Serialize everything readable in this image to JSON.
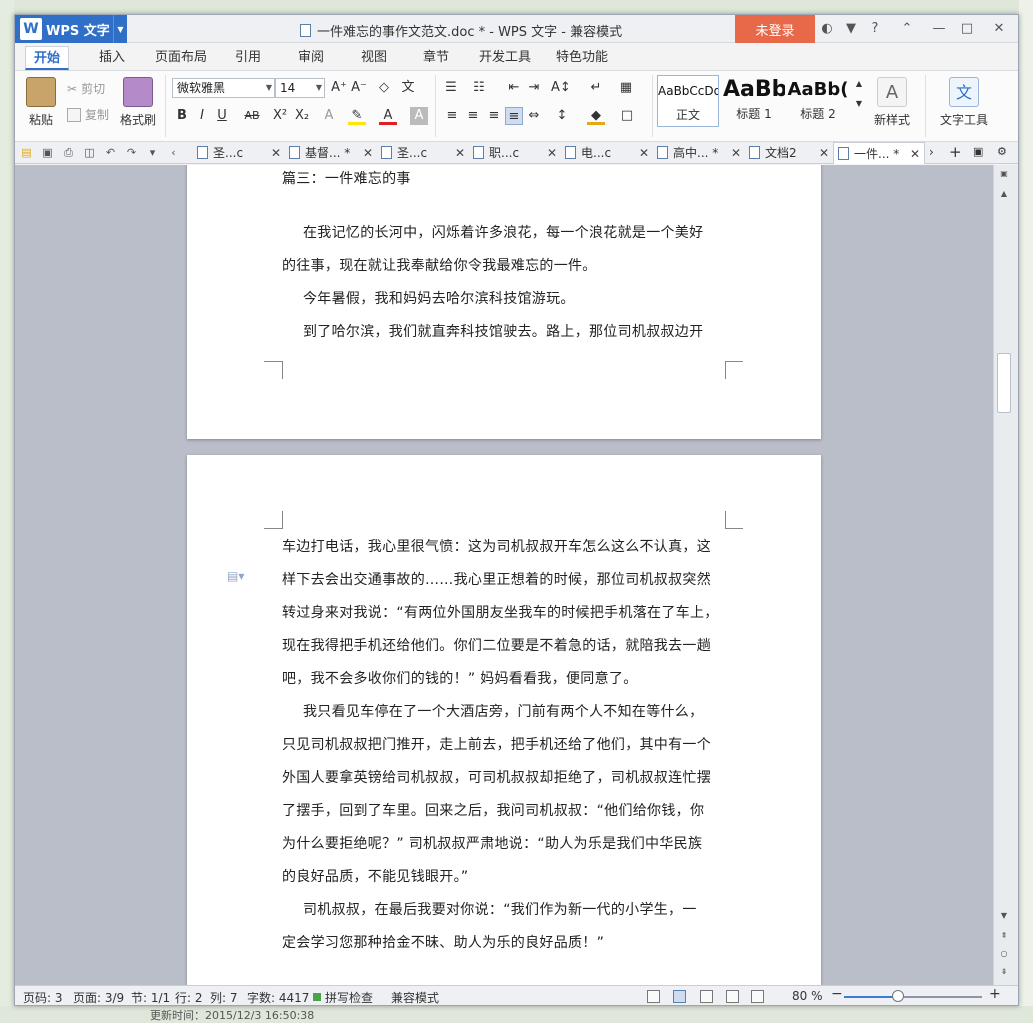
{
  "window": {
    "app_label": "WPS 文字",
    "title": "一件难忘的事作文范文.doc * - WPS 文字 - 兼容模式",
    "login_label": "未登录"
  },
  "menu": {
    "tabs": [
      "开始",
      "插入",
      "页面布局",
      "引用",
      "审阅",
      "视图",
      "章节",
      "开发工具",
      "特色功能"
    ]
  },
  "ribbon": {
    "paste": "粘贴",
    "cut": "剪切",
    "copy": "复制",
    "format_painter": "格式刷",
    "font_name": "微软雅黑",
    "font_size": "14",
    "styles": [
      {
        "preview": "AaBbCcDd",
        "name": "正文"
      },
      {
        "preview": "AaBb",
        "name": "标题 1"
      },
      {
        "preview": "AaBb(",
        "name": "标题 2"
      }
    ],
    "new_style": "新样式",
    "text_tools": "文字工具"
  },
  "doc_tabs": [
    {
      "label": "圣...c",
      "active": false
    },
    {
      "label": "基督... *",
      "active": false
    },
    {
      "label": "圣...c",
      "active": false
    },
    {
      "label": "职...c",
      "active": false
    },
    {
      "label": "电...c",
      "active": false
    },
    {
      "label": "高中... *",
      "active": false
    },
    {
      "label": "文档2",
      "active": false
    },
    {
      "label": "一件... *",
      "active": true
    }
  ],
  "page1": {
    "partial_heading": "篇三：一件难忘的事",
    "lines": [
      "在我记忆的长河中，闪烁着许多浪花，每一个浪花就是一个美好",
      "的往事，现在就让我奉献给你令我最难忘的一件。",
      "今年暑假，我和妈妈去哈尔滨科技馆游玩。",
      "到了哈尔滨，我们就直奔科技馆驶去。路上，那位司机叔叔边开"
    ]
  },
  "page2": {
    "lines": [
      "车边打电话，我心里很气愤：这为司机叔叔开车怎么这么不认真，这",
      "样下去会出交通事故的……我心里正想着的时候，那位司机叔叔突然",
      "转过身来对我说：“有两位外国朋友坐我车的时候把手机落在了车上，",
      "现在我得把手机还给他们。你们二位要是不着急的话，就陪我去一趟",
      "吧，我不会多收你们的钱的！” 妈妈看看我，便同意了。",
      "我只看见车停在了一个大酒店旁，门前有两个人不知在等什么，",
      "只见司机叔叔把门推开，走上前去，把手机还给了他们，其中有一个",
      "外国人要拿英镑给司机叔叔，可司机叔叔却拒绝了，司机叔叔连忙摆",
      "了摆手，回到了车里。回来之后，我问司机叔叔：“他们给你钱，你",
      "为什么要拒绝呢？” 司机叔叔严肃地说：“助人为乐是我们中华民族",
      "的良好品质，不能见钱眼开。”",
      "司机叔叔，在最后我要对你说：“我们作为新一代的小学生，一",
      "定会学习您那种拾金不昧、助人为乐的良好品质！”"
    ]
  },
  "status": {
    "page_num": "页码: 3",
    "pages": "页面: 3/9",
    "section": "节: 1/1",
    "row": "行: 2",
    "col": "列: 7",
    "word_count": "字数: 4417",
    "spell_check": "拼写检查",
    "compat_mode": "兼容模式",
    "zoom": "80 %",
    "zoom_fraction": 0.39
  },
  "background": {
    "bottom_text": "更新时间：2015/12/3 16:50:38"
  }
}
